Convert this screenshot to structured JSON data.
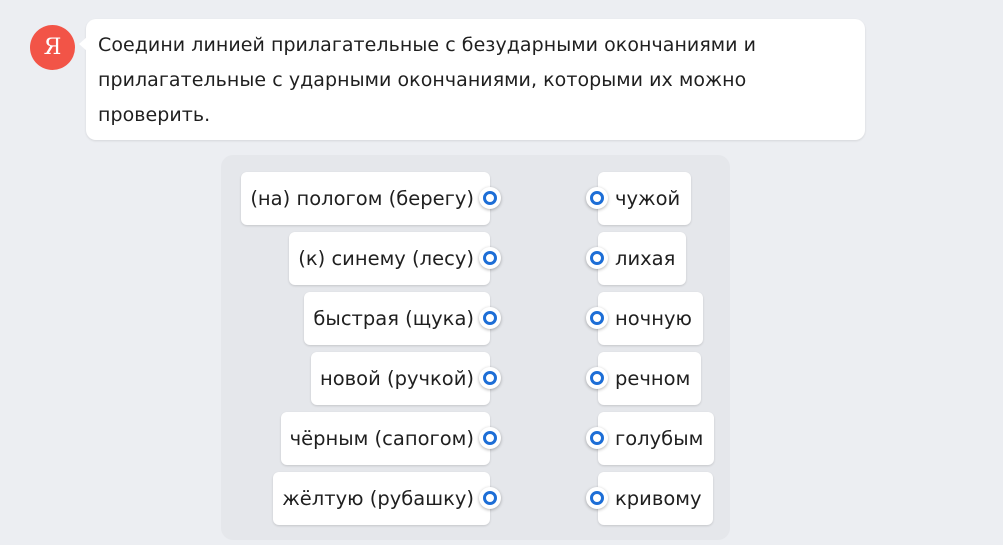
{
  "avatar": {
    "letter": "Я",
    "color": "#f25447"
  },
  "message": {
    "lines": [
      "Соедини линией прилагательные с безударными окончаниями и",
      "прилагательные с ударными окончаниями, которыми их можно",
      "проверить."
    ]
  },
  "exercise": {
    "left_items": [
      {
        "label": "(на) пологом (берегу)"
      },
      {
        "label": "(к) синему (лесу)"
      },
      {
        "label": "быстрая (щука)"
      },
      {
        "label": "новой (ручкой)"
      },
      {
        "label": "чёрным (сапогом)"
      },
      {
        "label": "жёлтую (рубашку)"
      }
    ],
    "right_items": [
      {
        "label": "чужой"
      },
      {
        "label": "лихая"
      },
      {
        "label": "ночную"
      },
      {
        "label": "речном"
      },
      {
        "label": "голубым"
      },
      {
        "label": "кривому"
      }
    ],
    "connector_color": "#1d6ed6"
  }
}
